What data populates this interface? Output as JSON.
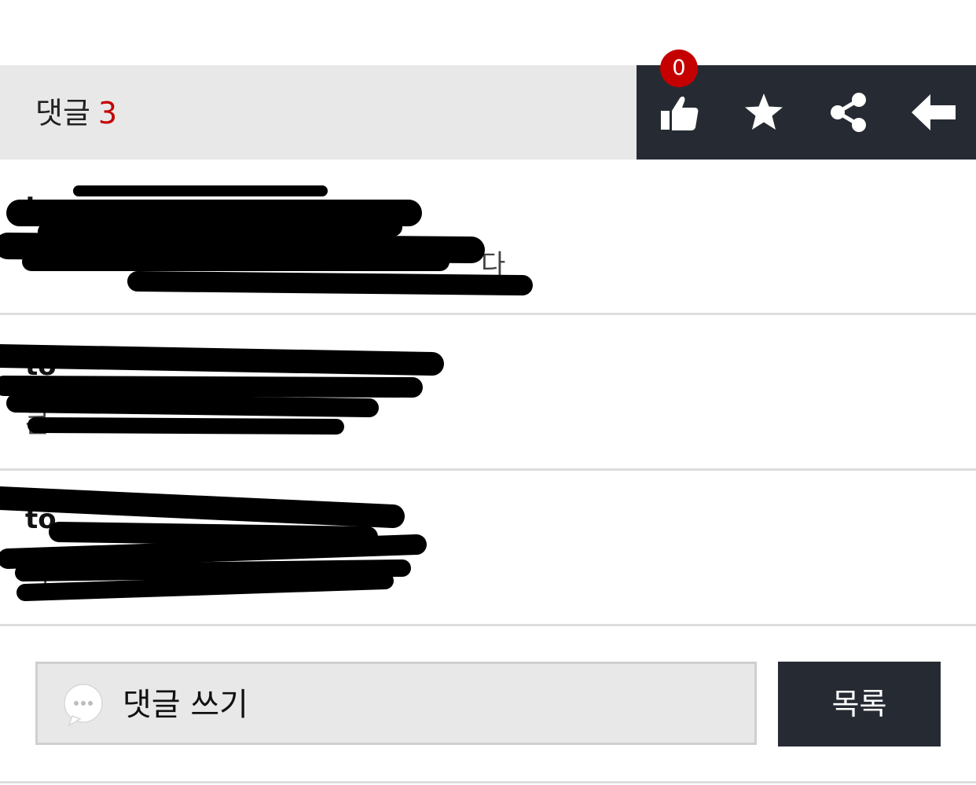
{
  "header": {
    "comment_label": "댓글",
    "comment_count": "3"
  },
  "actions": {
    "like_count": "0",
    "like_icon": "thumbs-up-icon",
    "bookmark_icon": "star-icon",
    "share_icon": "share-icon",
    "back_icon": "arrow-left-icon"
  },
  "comments": [
    {
      "author": "t",
      "text": "다"
    },
    {
      "author": "to",
      "text": "콘"
    },
    {
      "author": "to",
      "text": "너"
    }
  ],
  "write": {
    "icon": "speech-bubble-icon",
    "label": "댓글 쓰기"
  },
  "footer": {
    "list_button": "목록"
  },
  "colors": {
    "accent": "#c40000",
    "dark": "#262b33",
    "header_bg": "#e8e8e8",
    "divider": "#dddddd"
  }
}
